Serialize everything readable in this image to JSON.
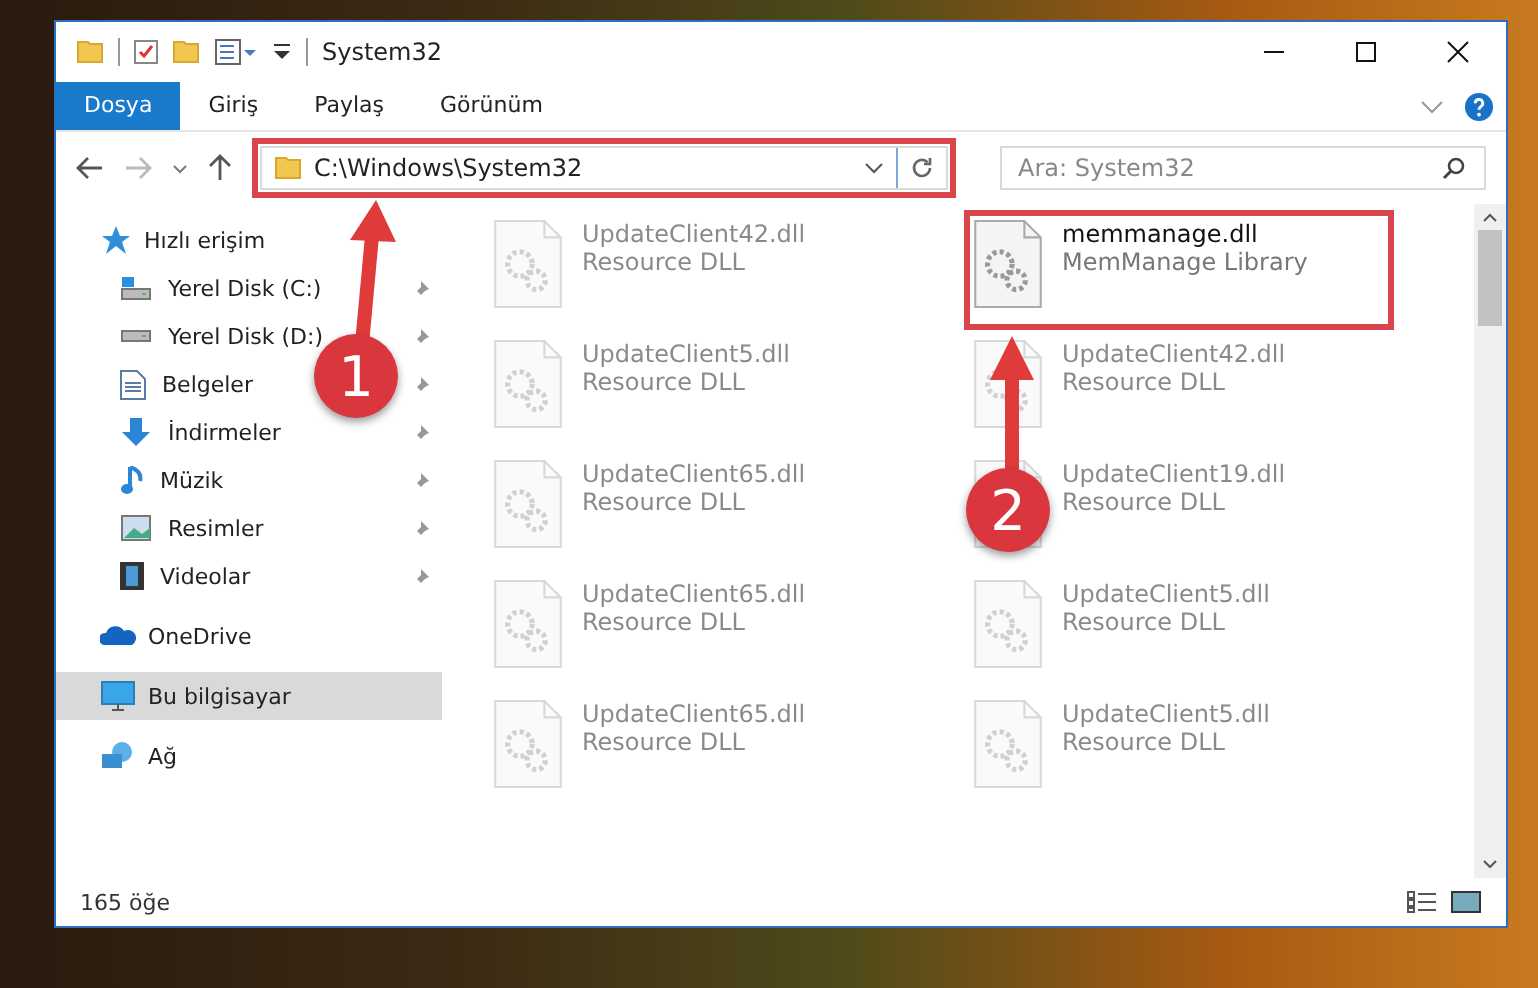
{
  "window": {
    "title": "System32"
  },
  "ribbon_tabs": [
    {
      "label": "Dosya",
      "kind": "file",
      "selected": false
    },
    {
      "label": "Giriş",
      "kind": "tab",
      "selected": false
    },
    {
      "label": "Paylaş",
      "kind": "tab",
      "selected": false
    },
    {
      "label": "Görünüm",
      "kind": "tab",
      "selected": false
    }
  ],
  "address": {
    "path": "C:\\Windows\\System32",
    "highlighted": true
  },
  "search": {
    "placeholder": "Ara: System32"
  },
  "sidebar": [
    {
      "label": "Hızlı erişim",
      "selected": false,
      "children": [
        {
          "label": "Yerel Disk (C:)",
          "pinned": true
        },
        {
          "label": "Yerel Disk (D:)",
          "pinned": true
        },
        {
          "label": "Belgeler",
          "pinned": true
        },
        {
          "label": "İndirmeler",
          "pinned": true
        },
        {
          "label": "Müzik",
          "pinned": true
        },
        {
          "label": "Resimler",
          "pinned": true
        },
        {
          "label": "Videolar",
          "pinned": true
        }
      ]
    },
    {
      "label": "OneDrive",
      "selected": false
    },
    {
      "label": "Bu bilgisayar",
      "selected": true
    },
    {
      "label": "Ağ",
      "selected": false
    }
  ],
  "files": [
    {
      "name": "UpdateClient42.dll",
      "description": "Resource DLL",
      "faded": true,
      "highlighted": false
    },
    {
      "name": "memmanage.dll",
      "description": "MemManage Library",
      "faded": false,
      "highlighted": true
    },
    {
      "name": "UpdateClient5.dll",
      "description": "Resource DLL",
      "faded": true,
      "highlighted": false
    },
    {
      "name": "UpdateClient42.dll",
      "description": "Resource DLL",
      "faded": true,
      "highlighted": false
    },
    {
      "name": "UpdateClient65.dll",
      "description": "Resource DLL",
      "faded": true,
      "highlighted": false
    },
    {
      "name": "UpdateClient19.dll",
      "description": "Resource DLL",
      "faded": true,
      "highlighted": false
    },
    {
      "name": "UpdateClient65.dll",
      "description": "Resource DLL",
      "faded": true,
      "highlighted": false
    },
    {
      "name": "UpdateClient5.dll",
      "description": "Resource DLL",
      "faded": true,
      "highlighted": false
    },
    {
      "name": "UpdateClient65.dll",
      "description": "Resource DLL",
      "faded": true,
      "highlighted": false
    },
    {
      "name": "UpdateClient5.dll",
      "description": "Resource DLL",
      "faded": true,
      "highlighted": false
    }
  ],
  "status_bar": {
    "count": "165 öğe"
  },
  "annotations": [
    {
      "label": "1"
    },
    {
      "label": "2"
    }
  ]
}
